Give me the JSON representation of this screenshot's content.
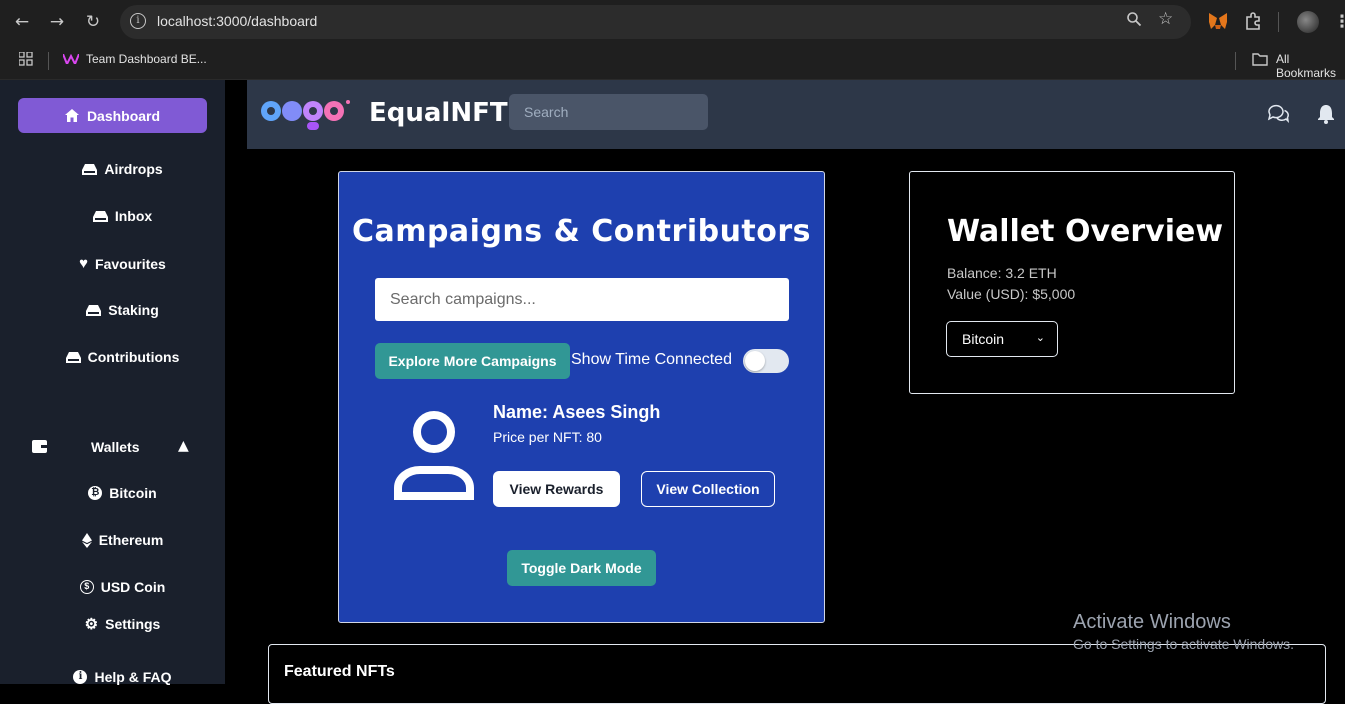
{
  "browser": {
    "url": "localhost:3000/dashboard",
    "bookmark_label": "Team Dashboard BE...",
    "all_bookmarks_label": "All Bookmarks"
  },
  "sidebar": {
    "dashboard_label": "Dashboard",
    "items": [
      {
        "label": "Airdrops",
        "icon": "drive-icon"
      },
      {
        "label": "Inbox",
        "icon": "inbox-icon"
      },
      {
        "label": "Favourites",
        "icon": "heart-icon"
      },
      {
        "label": "Staking",
        "icon": "drive-icon"
      },
      {
        "label": "Contributions",
        "icon": "drive-icon"
      }
    ],
    "wallets_label": "Wallets",
    "wallet_items": [
      {
        "label": "Bitcoin",
        "icon": "bitcoin-icon"
      },
      {
        "label": "Ethereum",
        "icon": "ethereum-icon"
      },
      {
        "label": "USD Coin",
        "icon": "dollar-icon"
      }
    ],
    "settings_label": "Settings",
    "help_label": "Help & FAQ"
  },
  "header": {
    "brand": "EqualNFT",
    "search_placeholder": "Search"
  },
  "campaigns": {
    "title": "Campaigns & Contributors",
    "search_placeholder": "Search campaigns...",
    "explore_label": "Explore More Campaigns",
    "toggle_label": "Show Time Connected",
    "toggle_on": false,
    "contributor_name": "Name: Asees Singh",
    "contributor_price": "Price per NFT: 80",
    "view_rewards_label": "View Rewards",
    "view_collection_label": "View Collection",
    "dark_mode_label": "Toggle Dark Mode"
  },
  "wallet": {
    "title": "Wallet Overview",
    "balance": "Balance: 3.2 ETH",
    "value": "Value (USD): $5,000",
    "selected": "Bitcoin"
  },
  "featured": {
    "title": "Featured NFTs"
  },
  "watermark": {
    "line1": "Activate Windows",
    "line2": "Go to Settings to activate Windows."
  },
  "colors": {
    "sidebar_bg": "#1a202c",
    "active_purple": "#805ad5",
    "header_bg": "#2d3748",
    "card_blue": "#1e40af",
    "teal": "#319795"
  }
}
